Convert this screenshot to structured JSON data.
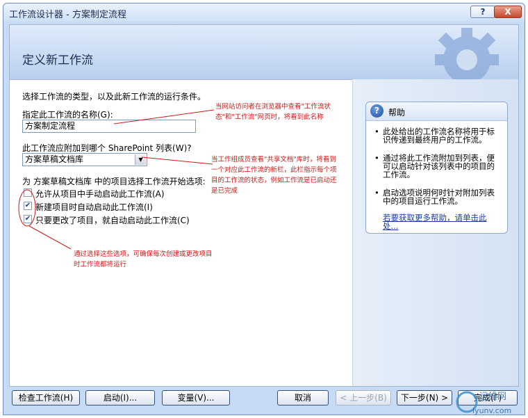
{
  "window": {
    "title": "工作流设计器 - 方案制定流程",
    "help_glyph": "?",
    "close_glyph": "X"
  },
  "banner": {
    "heading": "定义新工作流"
  },
  "form": {
    "intro": "选择工作流的类型，以及此新工作流的运行条件。",
    "name_label": "指定此工作流的名称(G):",
    "name_value": "方案制定流程",
    "list_label": "此工作流应附加到哪个 SharePoint 列表(W)?",
    "list_value": "方案草稿文档库",
    "start_label": "为 方案草稿文档库 中的项目选择工作流开始选项:",
    "options": [
      {
        "label": "允许从项目中手动启动此工作流(A)",
        "checked": false
      },
      {
        "label": "新建项目时自动启动此工作流(I)",
        "checked": true
      },
      {
        "label": "只要更改了项目，就自动启动此工作流(C)",
        "checked": true
      }
    ]
  },
  "annotations": {
    "note1_line1": "当网站访问者在浏览器中查看\"工作流状",
    "note1_line2": "态\"和\"工作流\"网页时，将看到此名称",
    "note2_line1": "当工作组成员查看\"共享文档\"库时，将看到",
    "note2_line2": "一个对应此工作流的新栏，此栏指示每个项",
    "note2_line3": "目的工作流的状态，例如工作流是已启动还",
    "note2_line4": "是已完成",
    "note3_line1": "通过选择这些选项，可确保每次创建或更改项目",
    "note3_line2": "时工作流都将运行"
  },
  "help": {
    "title": "帮助",
    "b1": "此处给出的工作流名称将用于标识传递到最终用户的工作流。",
    "b2": "通过将此工作流附加到列表，便可以启动针对该列表中的项目的工作流。",
    "b3": "启动选项说明何时针对附加列表中的项目运行工作流。",
    "link": "若要获取更多帮助，请单击此处..."
  },
  "buttons": {
    "check": "检查工作流(H)",
    "start": "启动(I)...",
    "variables": "变量(V)...",
    "cancel": "取消",
    "back": "< 上一步(B)",
    "next": "下一步(N) >",
    "finish": "完成(F)"
  },
  "watermark": {
    "text": "iyunv.com",
    "text2": "运维网"
  },
  "colors": {
    "annotation": "#cc1a1a",
    "link": "#1a3d9a",
    "banner": "#b8cfee"
  }
}
